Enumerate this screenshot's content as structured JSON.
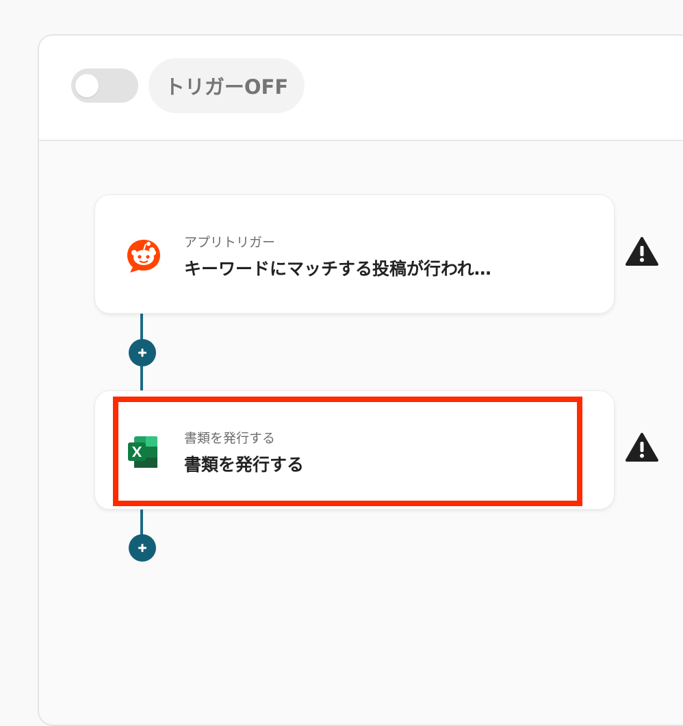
{
  "header": {
    "trigger_status": "トリガーOFF",
    "trigger_on": false
  },
  "steps": [
    {
      "kind": "アプリトリガー",
      "title": "キーワードにマッチする投稿が行われ…",
      "app_icon": "reddit-icon"
    },
    {
      "kind": "書類を発行する",
      "title": "書類を発行する",
      "app_icon": "excel-icon"
    }
  ],
  "icons": {
    "warning": "warning-icon",
    "add": "plus-icon"
  },
  "colors": {
    "connector": "#1d6a86",
    "add_button": "#145f78",
    "highlight": "#ff2a00",
    "reddit": "#ff4500",
    "excel": "#1d7a45",
    "warning": "#1f1f1f"
  }
}
